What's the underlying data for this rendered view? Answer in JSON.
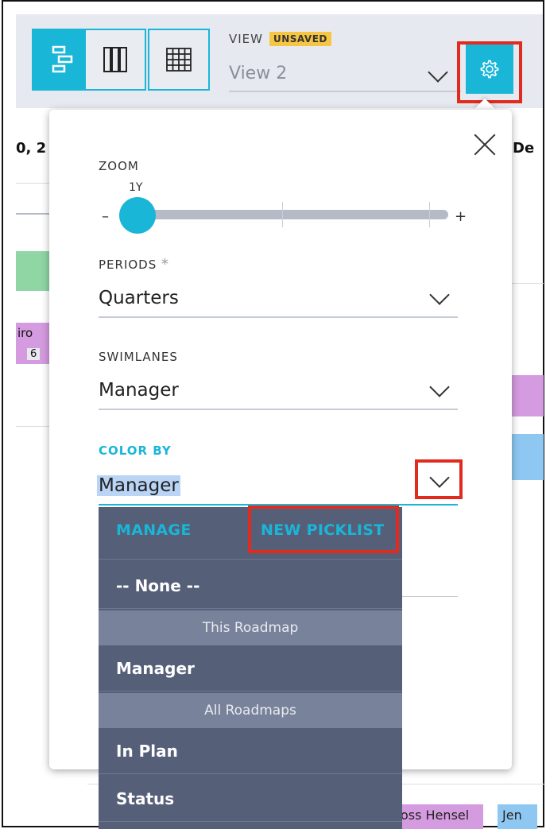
{
  "toolbar": {
    "view_label": "VIEW",
    "unsaved_badge": "UNSAVED",
    "view_value": "View 2",
    "view_buttons": [
      "timeline-view-icon",
      "columns-view-icon",
      "grid-view-icon"
    ],
    "settings_icon": "gear-icon"
  },
  "background": {
    "date_left": "0, 2",
    "date_right": "De",
    "card_text_1": "iro",
    "card_text_2": "6",
    "footer_name_1": "oss Hensel",
    "footer_name_2": "Jen"
  },
  "settings_panel": {
    "zoom": {
      "label": "ZOOM",
      "value": "1Y",
      "minus": "–",
      "plus": "+"
    },
    "periods": {
      "label": "PERIODS",
      "required_mark": "*",
      "value": "Quarters"
    },
    "swimlanes": {
      "label": "SWIMLANES",
      "value": "Manager"
    },
    "color_by": {
      "label": "COLOR BY",
      "value": "Manager"
    }
  },
  "color_by_dropdown": {
    "manage_label": "MANAGE",
    "new_picklist_label": "NEW PICKLIST",
    "none_option": "-- None --",
    "groups": [
      {
        "title": "This Roadmap",
        "options": [
          "Manager"
        ]
      },
      {
        "title": "All Roadmaps",
        "options": [
          "In Plan",
          "Status"
        ]
      }
    ]
  },
  "colors": {
    "accent": "#19b6d8",
    "badge": "#f6c542",
    "highlight_box": "#e02b1e",
    "dropdown_bg": "#555f78",
    "dropdown_group_bg": "#78829a"
  }
}
